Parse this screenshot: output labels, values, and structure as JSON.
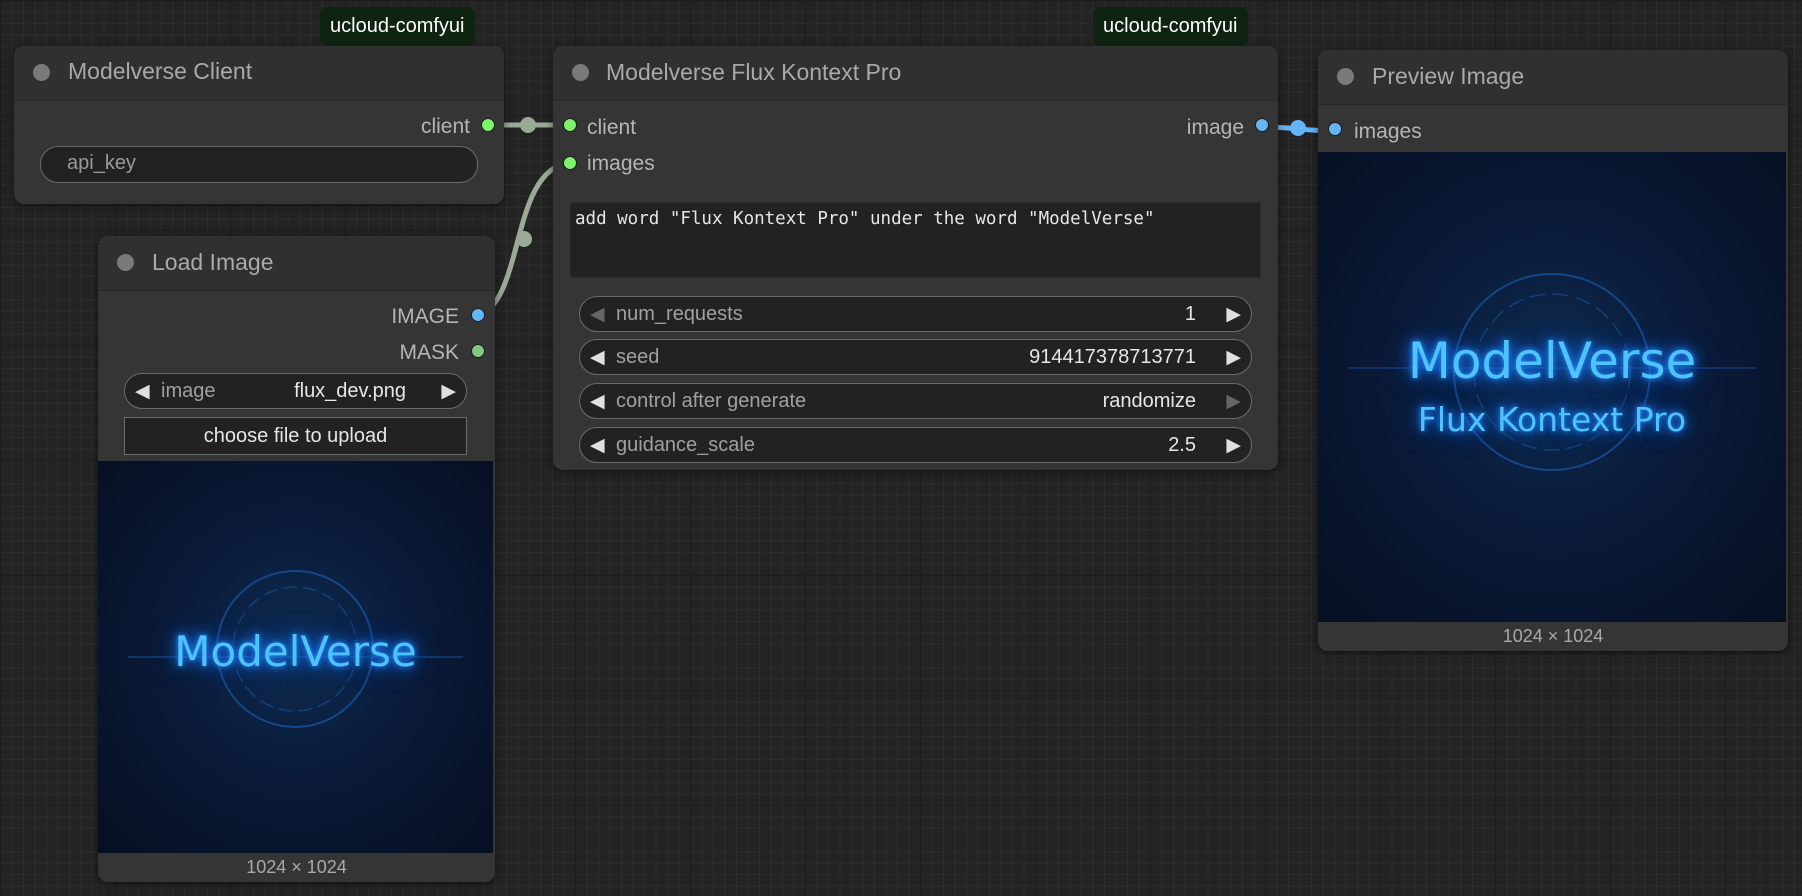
{
  "badges": {
    "left": "ucloud-comfyui",
    "right": "ucloud-comfyui"
  },
  "nodes": {
    "client": {
      "title": "Modelverse Client",
      "output": "client",
      "api_key_placeholder": "api_key"
    },
    "load_image": {
      "title": "Load Image",
      "outputs": [
        "IMAGE",
        "MASK"
      ],
      "image_widget": {
        "label": "image",
        "value": "flux_dev.png"
      },
      "upload_label": "choose file to upload",
      "image_text": "ModelVerse",
      "image_size": "1024 × 1024"
    },
    "flux": {
      "title": "Modelverse Flux Kontext Pro",
      "inputs": [
        "client",
        "images"
      ],
      "output": "image",
      "prompt": "add word \"Flux Kontext Pro\" under the word \"ModelVerse\"",
      "widgets": [
        {
          "label": "num_requests",
          "value": "1"
        },
        {
          "label": "seed",
          "value": "914417378713771"
        },
        {
          "label": "control after generate",
          "value": "randomize"
        },
        {
          "label": "guidance_scale",
          "value": "2.5"
        }
      ]
    },
    "preview": {
      "title": "Preview Image",
      "input": "images",
      "image_text_line1": "ModelVerse",
      "image_text_line2": "Flux Kontext Pro",
      "image_size": "1024 × 1024"
    }
  },
  "colors": {
    "link_client": "#9aaa96",
    "link_image": "#64b5f6",
    "slot_green": "#7ef26b",
    "slot_blue": "#64b5f6",
    "badge_bg": "#0e2411",
    "canvas_bg": "#232323",
    "node_bg": "#353535"
  }
}
